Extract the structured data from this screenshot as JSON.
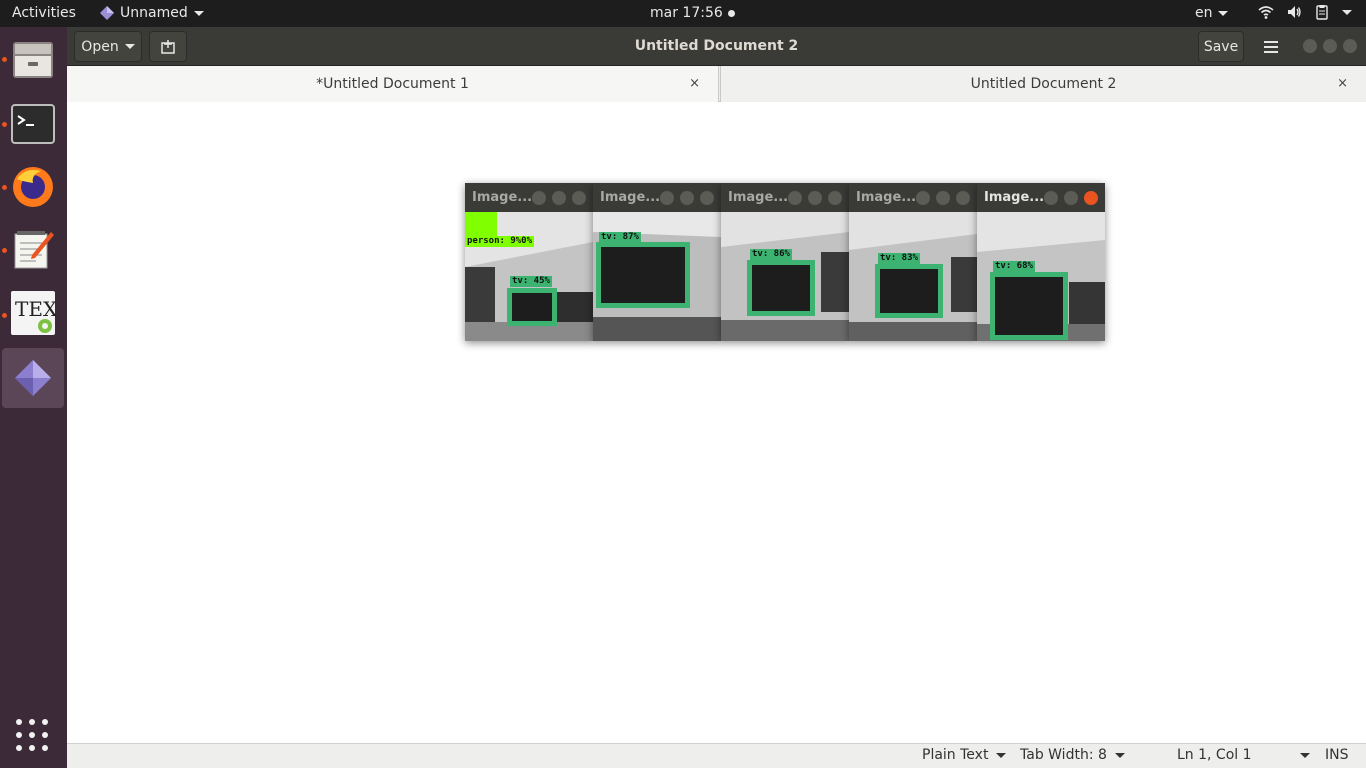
{
  "topbar": {
    "activities": "Activities",
    "app_name": "Unnamed",
    "clock": "mar 17:56",
    "lang": "en"
  },
  "dock": {
    "items": [
      {
        "name": "files",
        "icon": "file-cabinet-icon"
      },
      {
        "name": "terminal",
        "icon": "terminal-icon"
      },
      {
        "name": "firefox",
        "icon": "firefox-icon"
      },
      {
        "name": "text-editor",
        "icon": "text-editor-icon"
      },
      {
        "name": "texmaker",
        "icon": "tex-icon",
        "label": "TEX"
      },
      {
        "name": "unnamed",
        "icon": "gem-icon"
      }
    ]
  },
  "window": {
    "open_label": "Open",
    "save_label": "Save",
    "title": "Untitled Document 2",
    "tabs": [
      {
        "label": "*Untitled Document 1",
        "close": "×"
      },
      {
        "label": "Untitled Document 2",
        "close": "×"
      }
    ],
    "status": {
      "syntax": "Plain Text",
      "tab_width": "Tab Width: 8",
      "position": "Ln 1, Col 1",
      "mode": "INS"
    }
  },
  "image_windows": [
    {
      "title": "Image...",
      "detections": [
        {
          "label": "person: 9%0%",
          "kind": "person"
        },
        {
          "label": "tv: 45%",
          "kind": "tv"
        }
      ]
    },
    {
      "title": "Image...",
      "detections": [
        {
          "label": "tv: 87%",
          "kind": "tv"
        }
      ]
    },
    {
      "title": "Image...",
      "detections": [
        {
          "label": "tv: 86%",
          "kind": "tv"
        }
      ]
    },
    {
      "title": "Image...",
      "detections": [
        {
          "label": "tv: 83%",
          "kind": "tv"
        }
      ]
    },
    {
      "title": "Image...",
      "detections": [
        {
          "label": "tv: 68%",
          "kind": "tv"
        }
      ]
    }
  ],
  "colors": {
    "accent": "#e95420",
    "detection_box": "#3cb371",
    "person_label": "#7fff00"
  }
}
